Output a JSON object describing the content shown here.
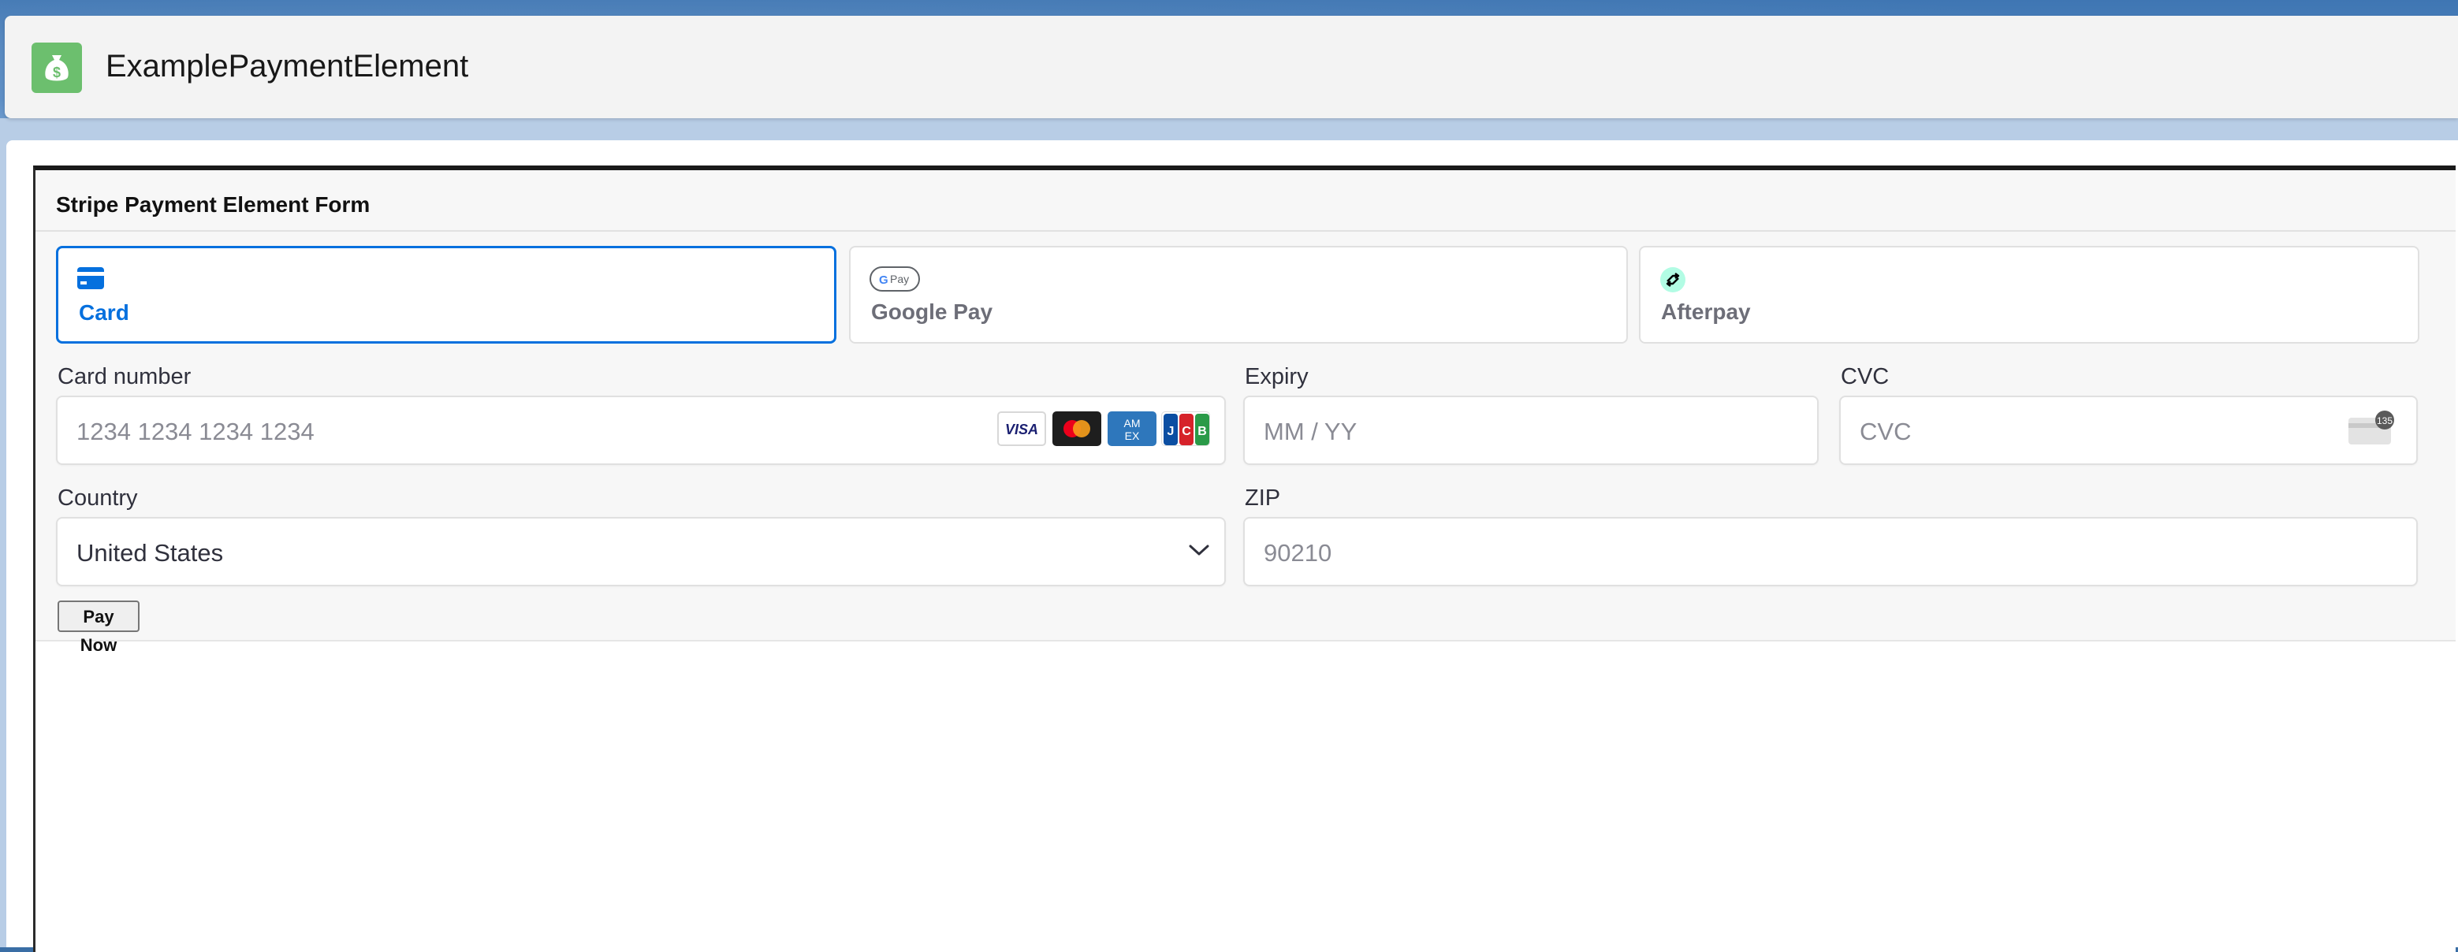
{
  "header": {
    "title": "ExamplePaymentElement",
    "icon": "money-bag-icon",
    "icon_color": "#6cbf6e"
  },
  "form": {
    "title": "Stripe Payment Element Form",
    "tabs": [
      {
        "label": "Card",
        "icon": "card-icon",
        "active": true
      },
      {
        "label": "Google Pay",
        "icon": "google-pay-icon",
        "active": false
      },
      {
        "label": "Afterpay",
        "icon": "afterpay-icon",
        "active": false
      }
    ],
    "card_number": {
      "label": "Card number",
      "placeholder": "1234 1234 1234 1234",
      "brands": [
        "visa",
        "mastercard",
        "amex",
        "jcb"
      ]
    },
    "expiry": {
      "label": "Expiry",
      "placeholder": "MM / YY"
    },
    "cvc": {
      "label": "CVC",
      "placeholder": "CVC",
      "icon_badge": "135"
    },
    "country": {
      "label": "Country",
      "value": "United States"
    },
    "zip": {
      "label": "ZIP",
      "placeholder": "90210"
    },
    "pay_button": "Pay Now"
  },
  "colors": {
    "accent": "#0570de",
    "afterpay": "#b2fce4"
  }
}
